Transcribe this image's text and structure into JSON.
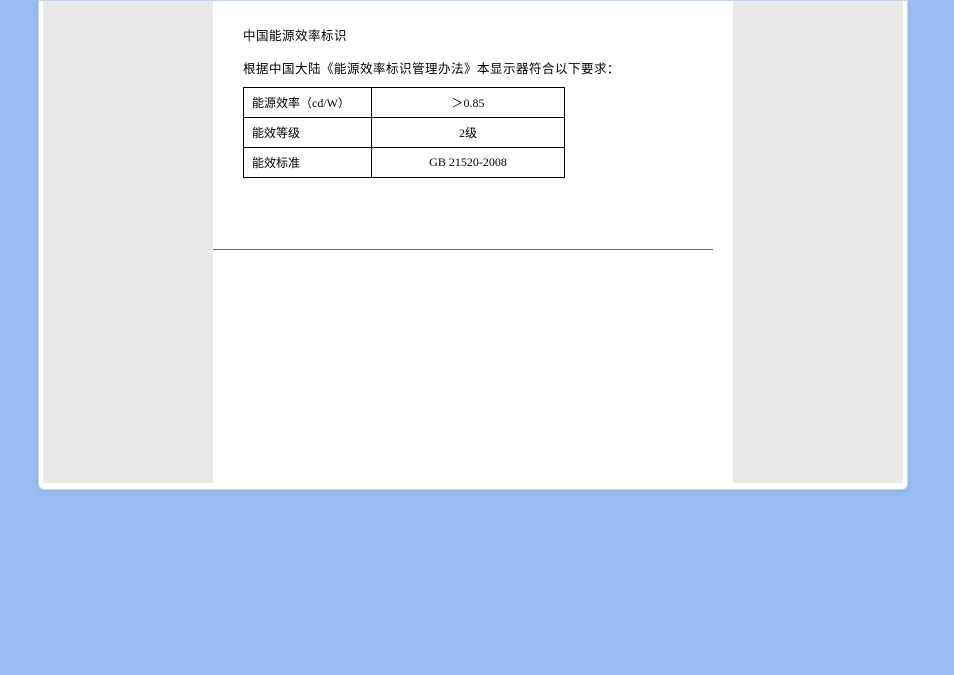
{
  "section": {
    "title": "中国能源效率标识",
    "description": "根据中国大陆《能源效率标识管理办法》本显示器符合以下要求："
  },
  "spec_table": {
    "rows": [
      {
        "label": "能源效率（cd/W）",
        "value": "＞0.85"
      },
      {
        "label": "能效等级",
        "value": "2级"
      },
      {
        "label": "能效标准",
        "value": "GB 21520-2008"
      }
    ]
  }
}
